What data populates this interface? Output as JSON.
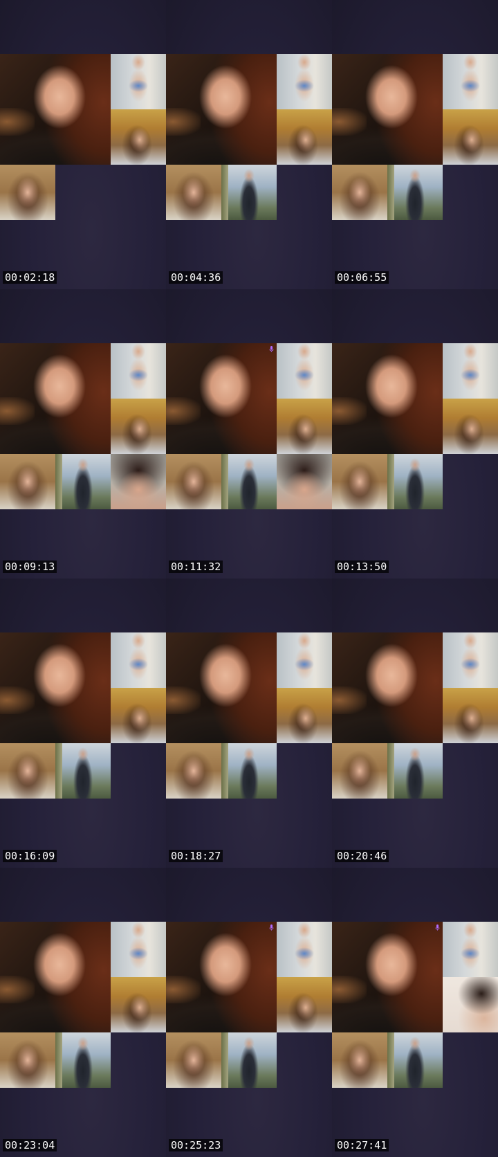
{
  "frames": [
    {
      "timestamp": "00:02:18",
      "tiles": [
        "bikini",
        "autumn",
        "smile"
      ],
      "mic": false
    },
    {
      "timestamp": "00:04:36",
      "tiles": [
        "bikini",
        "autumn",
        "smile",
        "man"
      ],
      "mic": false
    },
    {
      "timestamp": "00:06:55",
      "tiles": [
        "bikini",
        "autumn",
        "smile",
        "man"
      ],
      "mic": false
    },
    {
      "timestamp": "00:09:13",
      "tiles": [
        "bikini",
        "autumn",
        "smile",
        "man",
        "close"
      ],
      "mic": false
    },
    {
      "timestamp": "00:11:32",
      "tiles": [
        "bikini",
        "autumn",
        "smile",
        "man",
        "close"
      ],
      "mic": true
    },
    {
      "timestamp": "00:13:50",
      "tiles": [
        "bikini",
        "autumn",
        "smile",
        "man"
      ],
      "mic": false
    },
    {
      "timestamp": "00:16:09",
      "tiles": [
        "bikini",
        "autumn",
        "smile",
        "man"
      ],
      "mic": false
    },
    {
      "timestamp": "00:18:27",
      "tiles": [
        "bikini",
        "autumn",
        "smile",
        "man"
      ],
      "mic": false
    },
    {
      "timestamp": "00:20:46",
      "tiles": [
        "bikini",
        "autumn",
        "smile",
        "man"
      ],
      "mic": false
    },
    {
      "timestamp": "00:23:04",
      "tiles": [
        "bikini",
        "autumn",
        "smile",
        "man"
      ],
      "mic": false
    },
    {
      "timestamp": "00:25:23",
      "tiles": [
        "bikini",
        "autumn",
        "smile",
        "man"
      ],
      "mic": true
    },
    {
      "timestamp": "00:27:41",
      "tiles": [
        "bikini",
        "face",
        "smile",
        "man"
      ],
      "mic": true
    }
  ],
  "icons": {
    "mic": "microphone-icon"
  },
  "colors": {
    "background": "#1d1a2b",
    "mic_accent": "#b06bff",
    "timestamp_bg": "#000000",
    "timestamp_text": "#ffffff"
  }
}
